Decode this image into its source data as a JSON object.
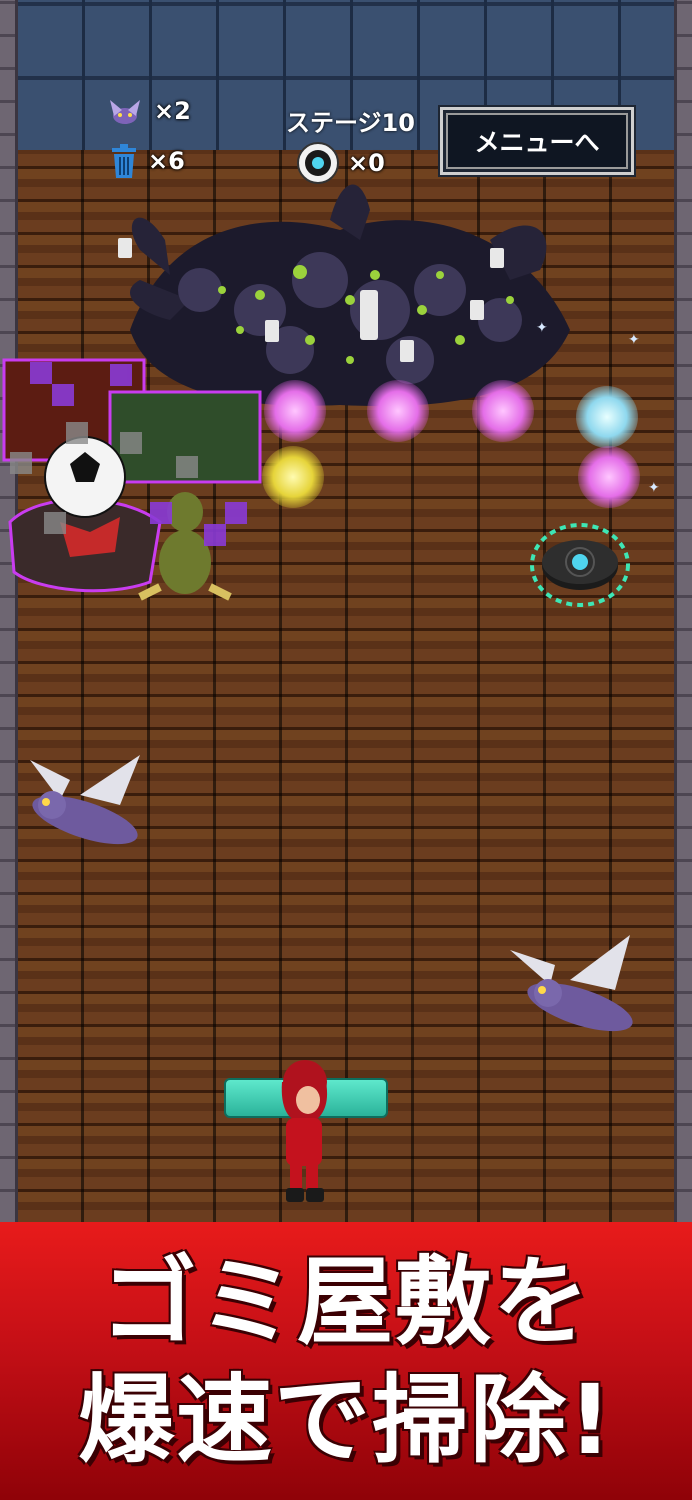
{
  "hud": {
    "lives_count": "×2",
    "trash_count": "×6",
    "stage_label": "ステージ10",
    "roomba_count": "×0",
    "menu_button": "メニューへ"
  },
  "icons": {
    "lives": "moth-enemy-icon",
    "trash": "trash-can-icon",
    "roomba": "robot-vacuum-icon"
  },
  "colors": {
    "banner_top": "#e81b1b",
    "banner_bottom": "#8f0208",
    "paddle": "#3fd0b5",
    "trash_icon": "#2f86d8"
  },
  "banner": {
    "line1": "ゴミ屋敷を",
    "line2": "爆速で掃除!"
  }
}
